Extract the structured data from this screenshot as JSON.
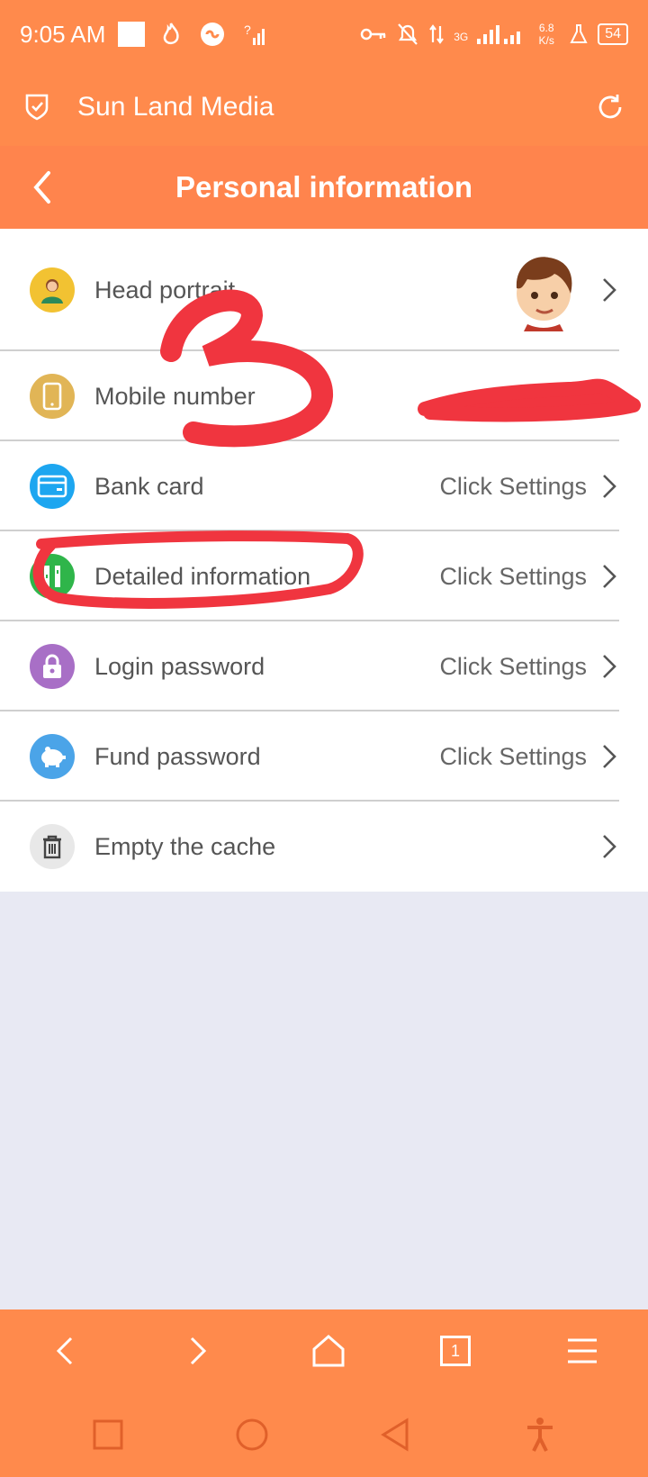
{
  "status_bar": {
    "time": "9:05 AM",
    "network_type": "3G",
    "net_speed": "6.8 K/s",
    "battery": "54"
  },
  "browser": {
    "title": "Sun Land Media"
  },
  "header": {
    "title": "Personal information"
  },
  "rows": [
    {
      "label": "Head portrait",
      "value": "",
      "icon": "person-icon",
      "icon_color": "#f2c232"
    },
    {
      "label": "Mobile number",
      "value": "",
      "icon": "phone-icon",
      "icon_color": "#e1b556"
    },
    {
      "label": "Bank card",
      "value": "Click Settings",
      "icon": "card-icon",
      "icon_color": "#1da6f0"
    },
    {
      "label": "Detailed information",
      "value": "Click Settings",
      "icon": "details-icon",
      "icon_color": "#2fb54a"
    },
    {
      "label": "Login password",
      "value": "Click Settings",
      "icon": "lock-icon",
      "icon_color": "#a86fc6"
    },
    {
      "label": "Fund password",
      "value": "Click Settings",
      "icon": "piggy-bank-icon",
      "icon_color": "#4ba4e8"
    },
    {
      "label": "Empty the cache",
      "value": "",
      "icon": "trash-icon",
      "icon_color": "#e8e8e8"
    }
  ],
  "annotations": {
    "handwritten_number": "3"
  },
  "browser_nav": {
    "tab_count": "1"
  },
  "colors": {
    "accent": "#ff8a4c",
    "header": "#ff844d",
    "annotation": "#f0353f",
    "page_bg": "#e8e9f3"
  }
}
